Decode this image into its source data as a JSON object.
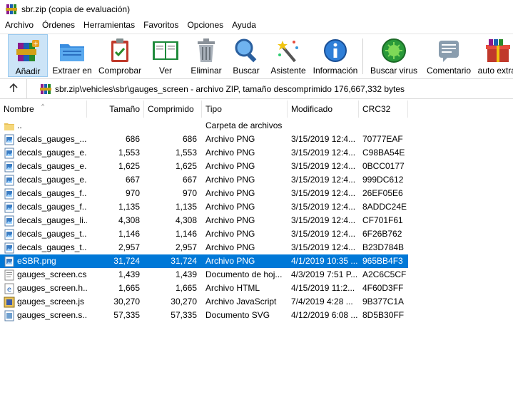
{
  "window": {
    "title": "sbr.zip (copia de evaluación)"
  },
  "menu": [
    "Archivo",
    "Órdenes",
    "Herramientas",
    "Favoritos",
    "Opciones",
    "Ayuda"
  ],
  "toolbar": {
    "buttons": [
      {
        "label": "Añadir",
        "icon": "add-archive-icon"
      },
      {
        "label": "Extraer en",
        "icon": "extract-folder-icon"
      },
      {
        "label": "Comprobar",
        "icon": "test-clipboard-icon"
      },
      {
        "label": "Ver",
        "icon": "book-view-icon"
      },
      {
        "label": "Eliminar",
        "icon": "trash-icon"
      },
      {
        "label": "Buscar",
        "icon": "magnifier-icon"
      },
      {
        "label": "Asistente",
        "icon": "wizard-wand-icon"
      },
      {
        "label": "Información",
        "icon": "info-icon"
      },
      {
        "label": "Buscar virus",
        "icon": "virus-scan-icon"
      },
      {
        "label": "Comentario",
        "icon": "comment-icon"
      },
      {
        "label": "auto extraí",
        "icon": "sfx-box-icon"
      }
    ]
  },
  "address": {
    "path": "sbr.zip\\vehicles\\sbr\\gauges_screen - archivo ZIP, tamaño descomprimido 176,667,332 bytes"
  },
  "columns": {
    "name": "Nombre",
    "size": "Tamaño",
    "packed": "Comprimido",
    "type": "Tipo",
    "modified": "Modificado",
    "crc": "CRC32"
  },
  "files": [
    {
      "name": "..",
      "size": "",
      "packed": "",
      "type": "Carpeta de archivos",
      "modified": "",
      "crc": "",
      "icon": "folder-icon",
      "selected": false
    },
    {
      "name": "decals_gauges_...",
      "size": "686",
      "packed": "686",
      "type": "Archivo PNG",
      "modified": "3/15/2019 12:4...",
      "crc": "70777EAF",
      "icon": "image-file-icon",
      "selected": false
    },
    {
      "name": "decals_gauges_e...",
      "size": "1,553",
      "packed": "1,553",
      "type": "Archivo PNG",
      "modified": "3/15/2019 12:4...",
      "crc": "C98BA54E",
      "icon": "image-file-icon",
      "selected": false
    },
    {
      "name": "decals_gauges_e...",
      "size": "1,625",
      "packed": "1,625",
      "type": "Archivo PNG",
      "modified": "3/15/2019 12:4...",
      "crc": "0BCC0177",
      "icon": "image-file-icon",
      "selected": false
    },
    {
      "name": "decals_gauges_e...",
      "size": "667",
      "packed": "667",
      "type": "Archivo PNG",
      "modified": "3/15/2019 12:4...",
      "crc": "999DC612",
      "icon": "image-file-icon",
      "selected": false
    },
    {
      "name": "decals_gauges_f...",
      "size": "970",
      "packed": "970",
      "type": "Archivo PNG",
      "modified": "3/15/2019 12:4...",
      "crc": "26EF05E6",
      "icon": "image-file-icon",
      "selected": false
    },
    {
      "name": "decals_gauges_f...",
      "size": "1,135",
      "packed": "1,135",
      "type": "Archivo PNG",
      "modified": "3/15/2019 12:4...",
      "crc": "8ADDC24E",
      "icon": "image-file-icon",
      "selected": false
    },
    {
      "name": "decals_gauges_li...",
      "size": "4,308",
      "packed": "4,308",
      "type": "Archivo PNG",
      "modified": "3/15/2019 12:4...",
      "crc": "CF701F61",
      "icon": "image-file-icon",
      "selected": false
    },
    {
      "name": "decals_gauges_t...",
      "size": "1,146",
      "packed": "1,146",
      "type": "Archivo PNG",
      "modified": "3/15/2019 12:4...",
      "crc": "6F26B762",
      "icon": "image-file-icon",
      "selected": false
    },
    {
      "name": "decals_gauges_t...",
      "size": "2,957",
      "packed": "2,957",
      "type": "Archivo PNG",
      "modified": "3/15/2019 12:4...",
      "crc": "B23D784B",
      "icon": "image-file-icon",
      "selected": false
    },
    {
      "name": "eSBR.png",
      "size": "31,724",
      "packed": "31,724",
      "type": "Archivo PNG",
      "modified": "4/1/2019 10:35 ...",
      "crc": "965BB4F3",
      "icon": "image-file-icon",
      "selected": true
    },
    {
      "name": "gauges_screen.css",
      "size": "1,439",
      "packed": "1,439",
      "type": "Documento de hoj...",
      "modified": "4/3/2019 7:51 P...",
      "crc": "A2C6C5CF",
      "icon": "css-file-icon",
      "selected": false
    },
    {
      "name": "gauges_screen.h...",
      "size": "1,665",
      "packed": "1,665",
      "type": "Archivo HTML",
      "modified": "4/15/2019 11:2...",
      "crc": "4F60D3FF",
      "icon": "html-file-icon",
      "selected": false
    },
    {
      "name": "gauges_screen.js",
      "size": "30,270",
      "packed": "30,270",
      "type": "Archivo JavaScript",
      "modified": "7/4/2019 4:28 ...",
      "crc": "9B377C1A",
      "icon": "js-file-icon",
      "selected": false
    },
    {
      "name": "gauges_screen.s...",
      "size": "57,335",
      "packed": "57,335",
      "type": "Documento SVG",
      "modified": "4/12/2019 6:08 ...",
      "crc": "8D5B30FF",
      "icon": "svg-file-icon",
      "selected": false
    }
  ]
}
